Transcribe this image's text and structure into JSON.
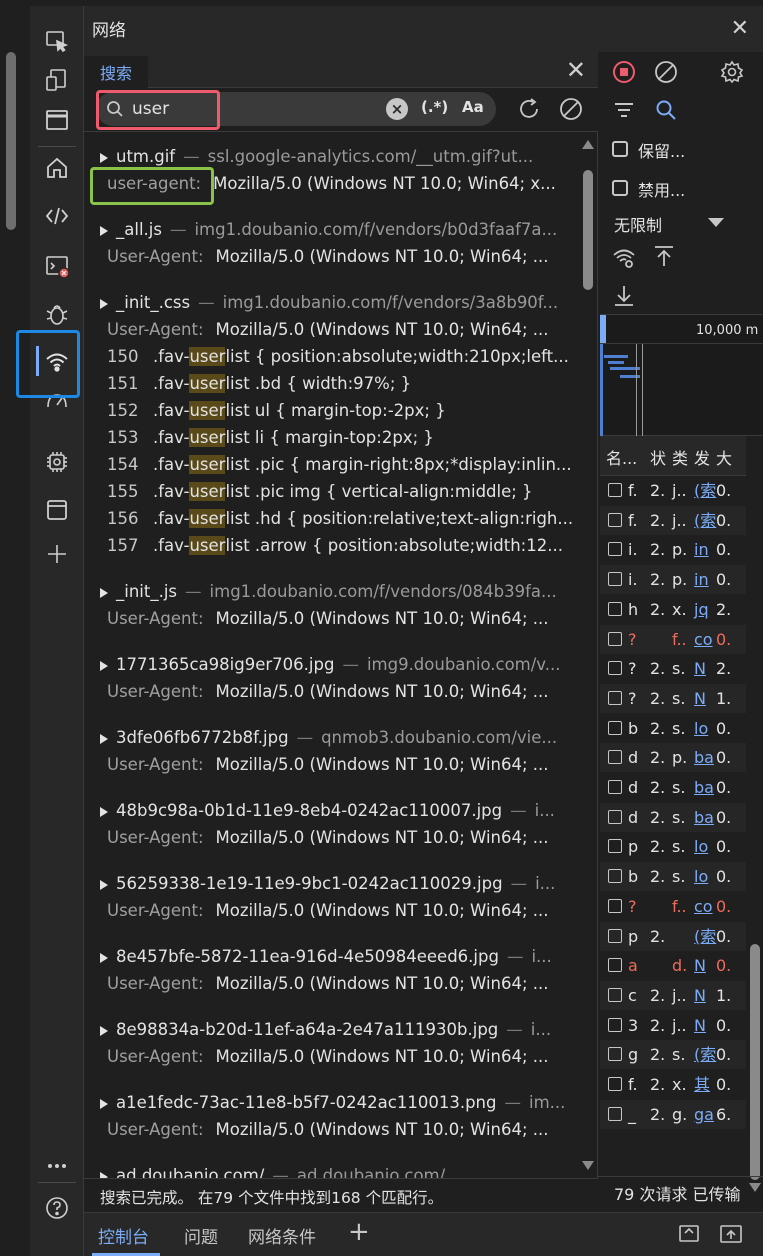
{
  "panel_title": "网络",
  "search": {
    "tab_label": "搜索",
    "query": "user",
    "regex_label": "(.*)",
    "case_label": "Aa",
    "status": "搜索已完成。 在79 个文件中找到168 个匹配行。"
  },
  "results": [
    {
      "type": "file",
      "name": "utm.gif",
      "dash": "—",
      "url": "ssl.google-analytics.com/__utm.gif?ut..."
    },
    {
      "type": "header",
      "key": "user-agent:",
      "value": "Mozilla/5.0 (Windows NT 10.0; Win64; x..."
    },
    {
      "type": "file",
      "name": "_all.js",
      "dash": "—",
      "url": "img1.doubanio.com/f/vendors/b0d3faaf7a..."
    },
    {
      "type": "header",
      "key": "User-Agent:",
      "value": "Mozilla/5.0 (Windows NT 10.0; Win64; ..."
    },
    {
      "type": "file",
      "name": "_init_.css",
      "dash": "—",
      "url": "img1.doubanio.com/f/vendors/3a8b90f..."
    },
    {
      "type": "header",
      "key": "User-Agent:",
      "value": "Mozilla/5.0 (Windows NT 10.0; Win64; ..."
    },
    {
      "type": "code",
      "ln": "150",
      "pre": ".fav-",
      "match": "user",
      "post": "list { position:absolute;width:210px;left..."
    },
    {
      "type": "code",
      "ln": "151",
      "pre": ".fav-",
      "match": "user",
      "post": "list .bd { width:97%; }"
    },
    {
      "type": "code",
      "ln": "152",
      "pre": ".fav-",
      "match": "user",
      "post": "list ul { margin-top:-2px; }"
    },
    {
      "type": "code",
      "ln": "153",
      "pre": ".fav-",
      "match": "user",
      "post": "list li { margin-top:2px; }"
    },
    {
      "type": "code",
      "ln": "154",
      "pre": ".fav-",
      "match": "user",
      "post": "list .pic { margin-right:8px;*display:inlin..."
    },
    {
      "type": "code",
      "ln": "155",
      "pre": ".fav-",
      "match": "user",
      "post": "list .pic img { vertical-align:middle; }"
    },
    {
      "type": "code",
      "ln": "156",
      "pre": ".fav-",
      "match": "user",
      "post": "list .hd { position:relative;text-align:righ..."
    },
    {
      "type": "code",
      "ln": "157",
      "pre": ".fav-",
      "match": "user",
      "post": "list .arrow { position:absolute;width:12..."
    },
    {
      "type": "file",
      "name": "_init_.js",
      "dash": "—",
      "url": "img1.doubanio.com/f/vendors/084b39fa..."
    },
    {
      "type": "header",
      "key": "User-Agent:",
      "value": "Mozilla/5.0 (Windows NT 10.0; Win64; ..."
    },
    {
      "type": "file",
      "name": "1771365ca98ig9er706.jpg",
      "dash": "—",
      "url": "img9.doubanio.com/v..."
    },
    {
      "type": "header",
      "key": "User-Agent:",
      "value": "Mozilla/5.0 (Windows NT 10.0; Win64; ..."
    },
    {
      "type": "file",
      "name": "3dfe06fb6772b8f.jpg",
      "dash": "—",
      "url": "qnmob3.doubanio.com/vie..."
    },
    {
      "type": "header",
      "key": "User-Agent:",
      "value": "Mozilla/5.0 (Windows NT 10.0; Win64; ..."
    },
    {
      "type": "file",
      "name": "48b9c98a-0b1d-11e9-8eb4-0242ac110007.jpg",
      "dash": "—",
      "url": "i..."
    },
    {
      "type": "header",
      "key": "User-Agent:",
      "value": "Mozilla/5.0 (Windows NT 10.0; Win64; ..."
    },
    {
      "type": "file",
      "name": "56259338-1e19-11e9-9bc1-0242ac110029.jpg",
      "dash": "—",
      "url": "i..."
    },
    {
      "type": "header",
      "key": "User-Agent:",
      "value": "Mozilla/5.0 (Windows NT 10.0; Win64; ..."
    },
    {
      "type": "file",
      "name": "8e457bfe-5872-11ea-916d-4e50984eeed6.jpg",
      "dash": "—",
      "url": "i..."
    },
    {
      "type": "header",
      "key": "User-Agent:",
      "value": "Mozilla/5.0 (Windows NT 10.0; Win64; ..."
    },
    {
      "type": "file",
      "name": "8e98834a-b20d-11ef-a64a-2e47a111930b.jpg",
      "dash": "—",
      "url": "i..."
    },
    {
      "type": "header",
      "key": "User-Agent:",
      "value": "Mozilla/5.0 (Windows NT 10.0; Win64; ..."
    },
    {
      "type": "file",
      "name": "a1e1fedc-73ac-11e8-b5f7-0242ac110013.png",
      "dash": "—",
      "url": "im..."
    },
    {
      "type": "header",
      "key": "User-Agent:",
      "value": "Mozilla/5.0 (Windows NT 10.0; Win64; ..."
    },
    {
      "type": "file",
      "name": "ad.doubanio.com/",
      "dash": "—",
      "url": "ad.doubanio.com/"
    }
  ],
  "network": {
    "preserve_log": "保留...",
    "disable_cache": "禁用...",
    "throttle": "无限制",
    "overview_label": "10,000 m",
    "headers": [
      "名...",
      "状",
      "类",
      "发",
      "大"
    ],
    "rows": [
      {
        "n": "f.",
        "s": "2.",
        "t": "j..",
        "i": "(索",
        "z": "0."
      },
      {
        "n": "f.",
        "s": "2.",
        "t": "j..",
        "i": "(索",
        "z": "0."
      },
      {
        "n": "i.",
        "s": "2.",
        "t": "p.",
        "i": "in",
        "z": "0."
      },
      {
        "n": "i.",
        "s": "2.",
        "t": "p.",
        "i": "in",
        "z": "0."
      },
      {
        "n": "h",
        "s": "2.",
        "t": "x.",
        "i": "jq",
        "z": "2."
      },
      {
        "n": "?",
        "s": "",
        "t": "f..",
        "i": "co",
        "z": "0.",
        "red": true
      },
      {
        "n": "?",
        "s": "2.",
        "t": "s.",
        "i": "N",
        "z": "2."
      },
      {
        "n": "?",
        "s": "2.",
        "t": "s.",
        "i": "N",
        "z": "1."
      },
      {
        "n": "b",
        "s": "2.",
        "t": "s.",
        "i": "lo",
        "z": "0."
      },
      {
        "n": "d",
        "s": "2.",
        "t": "p.",
        "i": "ba",
        "z": "0."
      },
      {
        "n": "d",
        "s": "2.",
        "t": "s.",
        "i": "ba",
        "z": "0."
      },
      {
        "n": "d",
        "s": "2.",
        "t": "s.",
        "i": "ba",
        "z": "0."
      },
      {
        "n": "p",
        "s": "2.",
        "t": "s.",
        "i": "lo",
        "z": "0."
      },
      {
        "n": "b",
        "s": "2.",
        "t": "s.",
        "i": "lo",
        "z": "0."
      },
      {
        "n": "?",
        "s": "",
        "t": "f..",
        "i": "co",
        "z": "0.",
        "red": true
      },
      {
        "n": "p",
        "s": "2.",
        "t": "",
        "i": "(索",
        "z": "0."
      },
      {
        "n": "a",
        "s": "",
        "t": "d.",
        "i": "N",
        "z": "0.",
        "red": true
      },
      {
        "n": "c",
        "s": "2.",
        "t": "j..",
        "i": "N",
        "z": "1."
      },
      {
        "n": "3",
        "s": "2.",
        "t": "j..",
        "i": "N",
        "z": "0."
      },
      {
        "n": "g",
        "s": "2.",
        "t": "s.",
        "i": "(索",
        "z": "0."
      },
      {
        "n": "f.",
        "s": "2.",
        "t": "x.",
        "i": "其",
        "z": "0."
      },
      {
        "n": "_",
        "s": "2.",
        "t": "g.",
        "i": "ga",
        "z": "6."
      }
    ],
    "status": "79 次请求  已传输"
  },
  "drawer": {
    "tabs": [
      "控制台",
      "问题",
      "网络条件"
    ]
  }
}
